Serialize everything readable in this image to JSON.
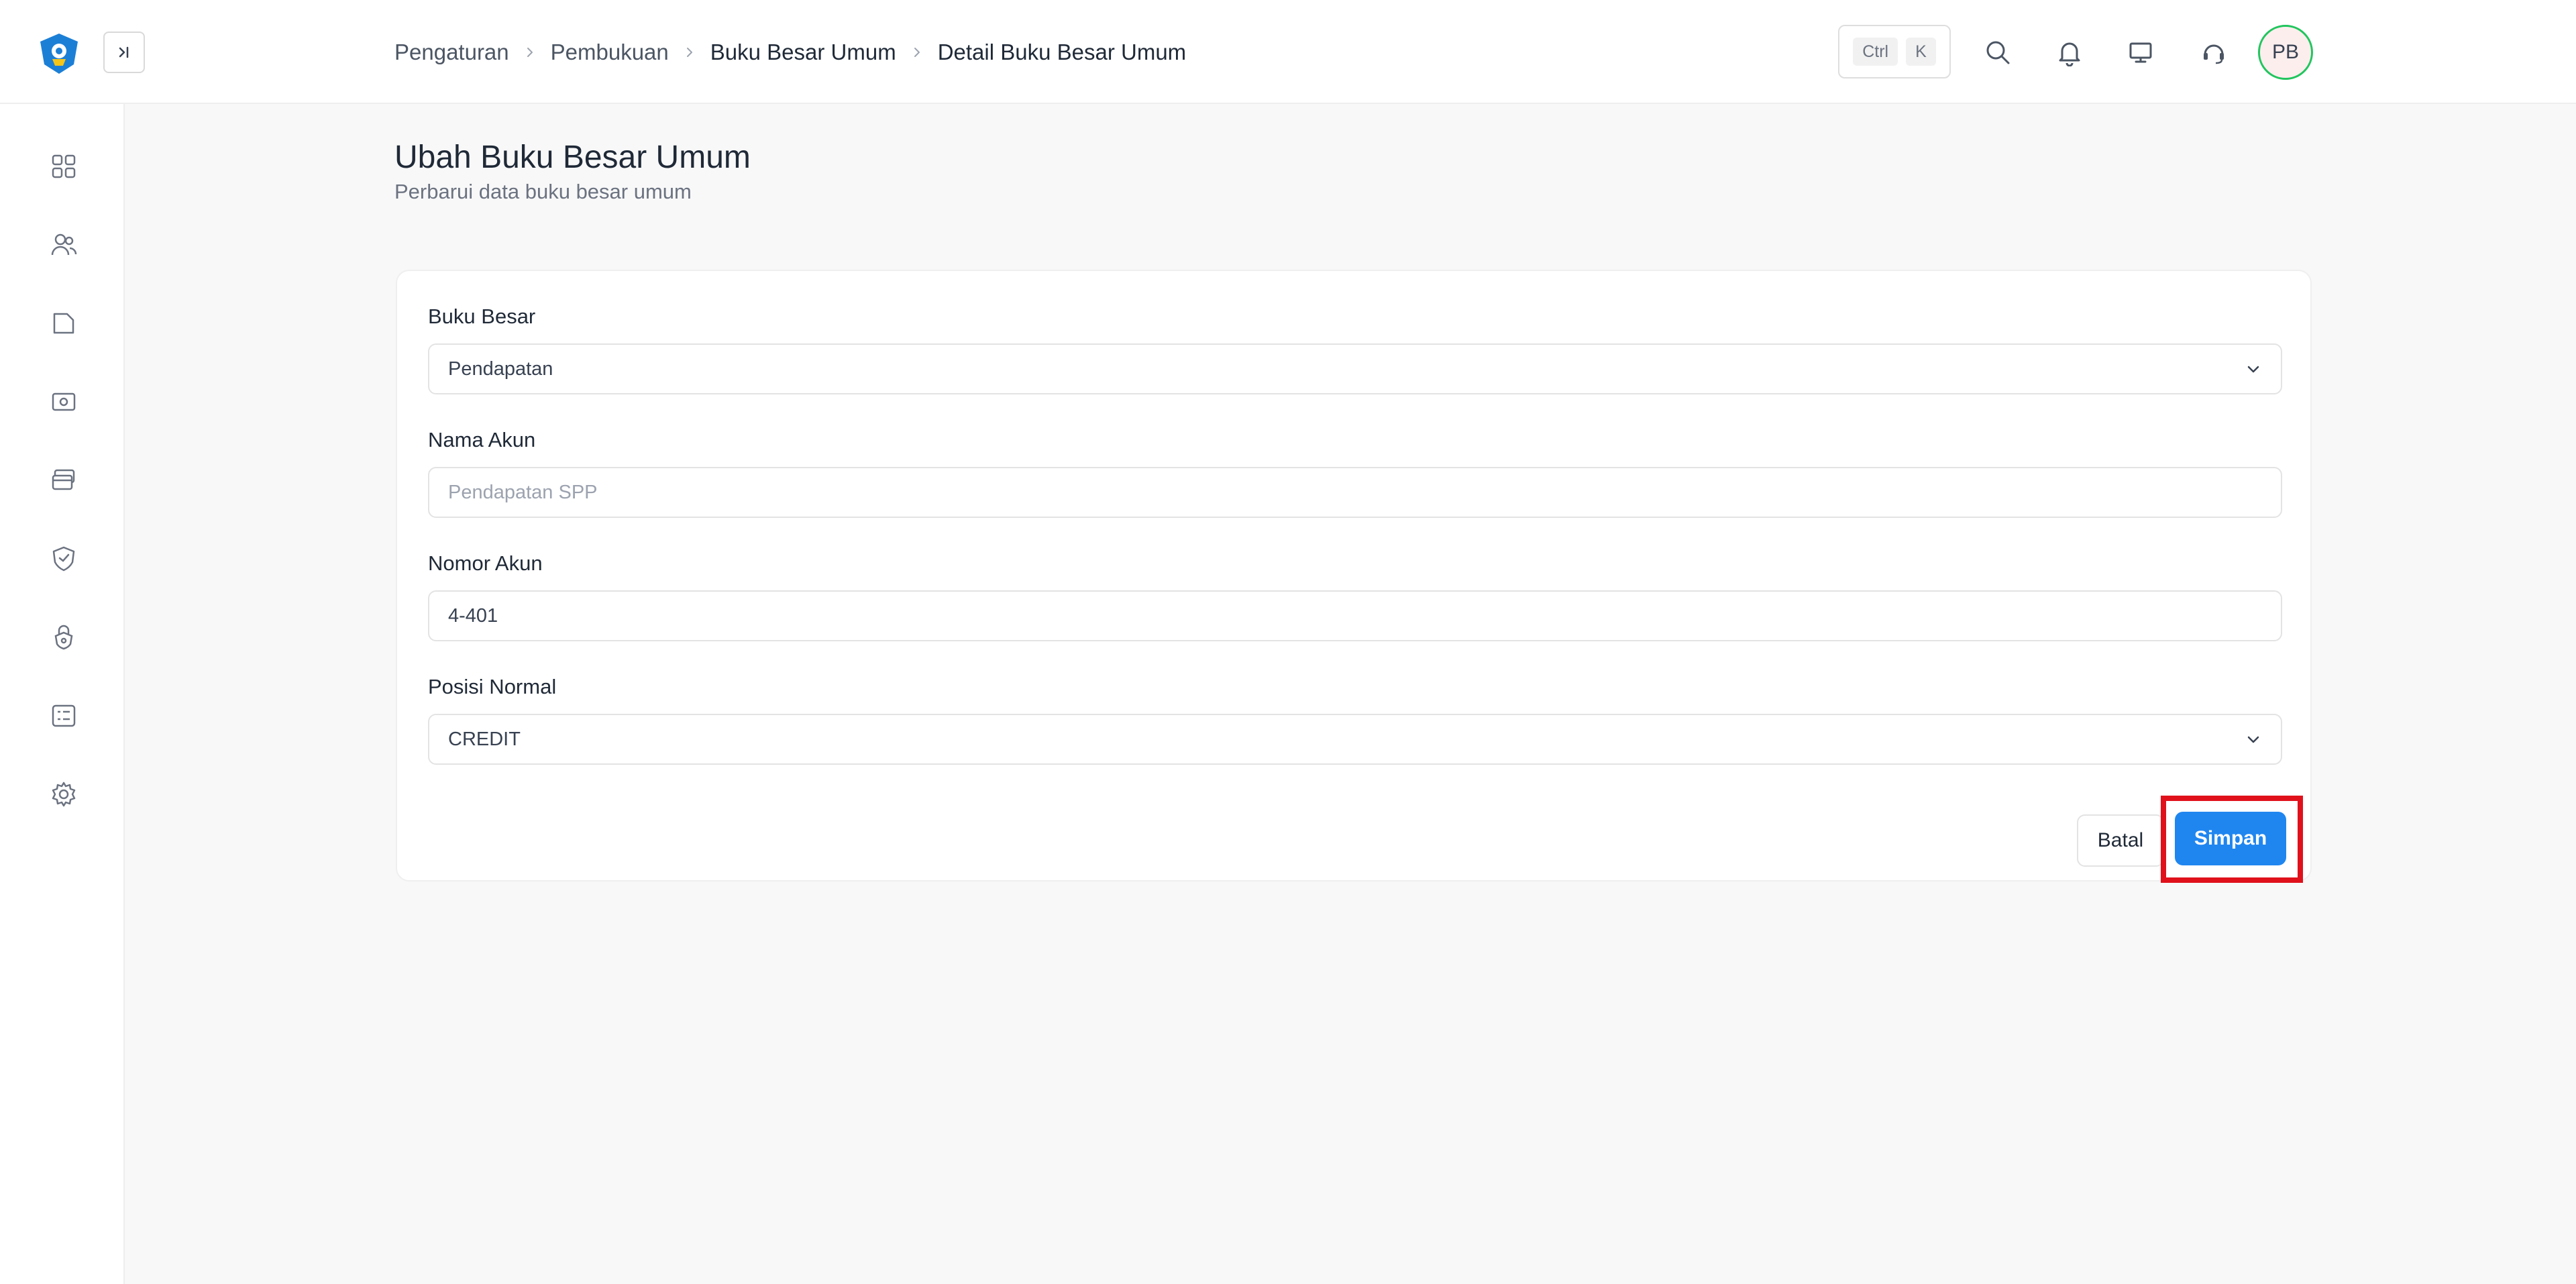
{
  "breadcrumb": {
    "items": [
      "Pengaturan",
      "Pembukuan",
      "Buku Besar Umum",
      "Detail Buku Besar Umum"
    ]
  },
  "shortcut": {
    "key1": "Ctrl",
    "key2": "K"
  },
  "user": {
    "initials": "PB"
  },
  "page": {
    "title": "Ubah Buku Besar Umum",
    "subtitle": "Perbarui data buku besar umum"
  },
  "form": {
    "ledger": {
      "label": "Buku Besar",
      "value": "Pendapatan"
    },
    "account_name": {
      "label": "Nama Akun",
      "placeholder": "Pendapatan SPP",
      "value": ""
    },
    "account_number": {
      "label": "Nomor Akun",
      "value": "4-401"
    },
    "normal_position": {
      "label": "Posisi Normal",
      "value": "CREDIT"
    }
  },
  "actions": {
    "cancel": "Batal",
    "save": "Simpan"
  },
  "colors": {
    "primary": "#1f86f0",
    "highlight": "#e0111b",
    "avatar_ring": "#22c55e"
  },
  "sidebar_icons": [
    "dashboard-icon",
    "users-icon",
    "folder-icon",
    "cash-icon",
    "wallet-icon",
    "badge-icon",
    "lock-icon",
    "list-icon",
    "settings-icon"
  ]
}
